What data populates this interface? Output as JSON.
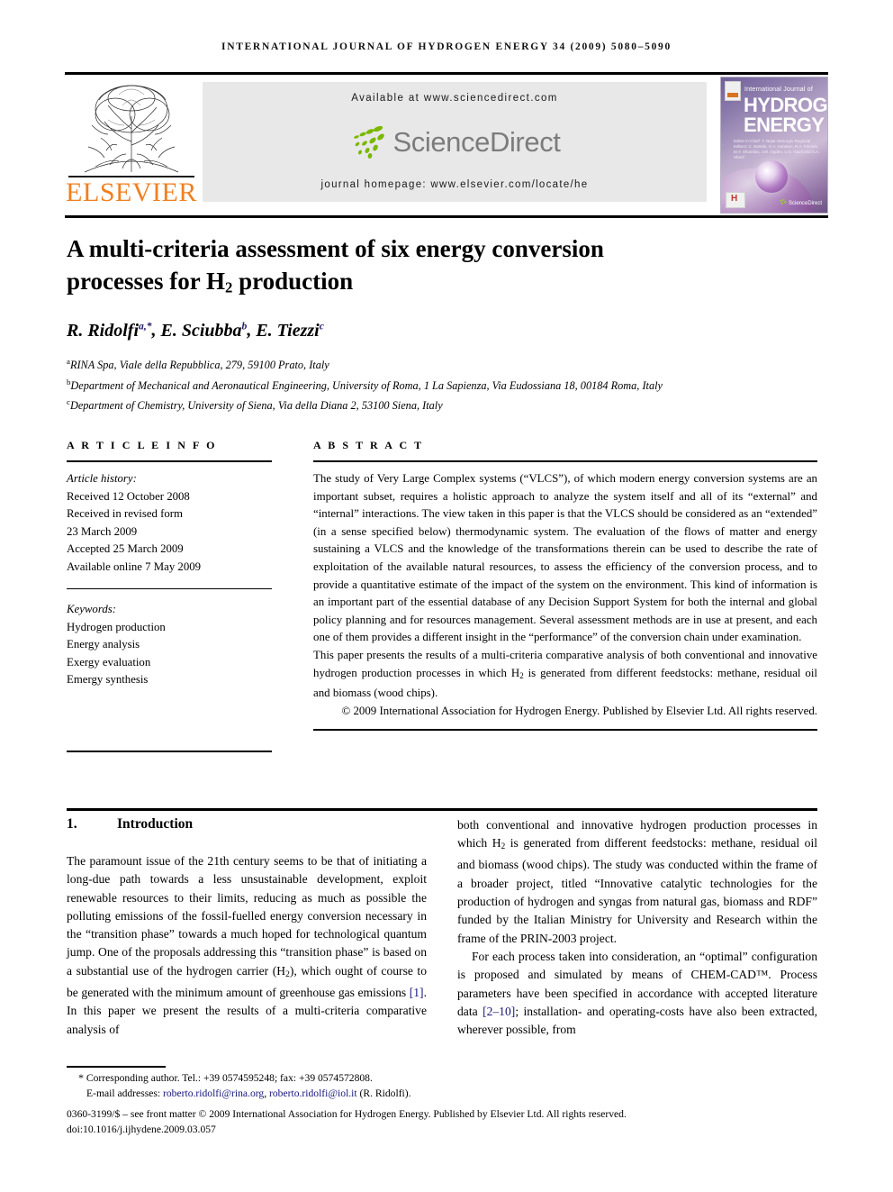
{
  "running_head": "International Journal of Hydrogen Energy 34 (2009) 5080–5090",
  "masthead": {
    "publisher_name": "ELSEVIER",
    "available_at": "Available at www.sciencedirect.com",
    "sciencedirect_wordmark": "ScienceDirect",
    "journal_homepage": "journal homepage: www.elsevier.com/locate/he",
    "cover": {
      "line1": "International Journal of",
      "line2": "HYDROGEN",
      "line3": "ENERGY",
      "editors": "Editor-in-Chief:  T. Nejat Veziroglu    Regional Editors:  C. Bartels, G.A. Karakoc, R.A. Ferrara, M.Y. Shumilov, J.M. Ogden, U.S. Gavit and S.A. Sherif",
      "sciencedirect_badge": "ScienceDirect"
    }
  },
  "article": {
    "title_line1": "A multi-criteria assessment of six energy conversion",
    "title_line2_pre": "processes for H",
    "title_sub": "2",
    "title_line2_post": " production",
    "authors": [
      {
        "name": "R. Ridolfi",
        "sup": "a,*"
      },
      {
        "name": "E. Sciubba",
        "sup": "b"
      },
      {
        "name": "E. Tiezzi",
        "sup": "c"
      }
    ],
    "affiliations": [
      {
        "mark": "a",
        "text": "RINA Spa, Viale della Repubblica, 279, 59100 Prato, Italy"
      },
      {
        "mark": "b",
        "text": "Department of Mechanical and Aeronautical Engineering, University of Roma, 1 La Sapienza, Via Eudossiana 18, 00184 Roma, Italy"
      },
      {
        "mark": "c",
        "text": "Department of Chemistry, University of Siena, Via della Diana 2, 53100 Siena, Italy"
      }
    ]
  },
  "article_info": {
    "heading": "A R T I C L E   I N F O",
    "history_label": "Article history:",
    "history": [
      "Received 12 October 2008",
      "Received in revised form",
      "23 March 2009",
      "Accepted 25 March 2009",
      "Available online 7 May 2009"
    ],
    "keywords_label": "Keywords:",
    "keywords": [
      "Hydrogen production",
      "Energy analysis",
      "Exergy evaluation",
      "Emergy synthesis"
    ]
  },
  "abstract": {
    "heading": "A B S T R A C T",
    "paragraph1": "The study of Very Large Complex systems (“VLCS”), of which modern energy conversion systems are an important subset, requires a holistic approach to analyze the system itself and all of its “external” and “internal” interactions. The view taken in this paper is that the VLCS should be considered as an “extended” (in a sense specified below) thermodynamic system. The evaluation of the flows of matter and energy sustaining a VLCS and the knowledge of the transformations therein can be used to describe the rate of exploitation of the available natural resources, to assess the efficiency of the conversion process, and to provide a quantitative estimate of the impact of the system on the environment. This kind of information is an important part of the essential database of any Decision Support System for both the internal and global policy planning and for resources management. Several assessment methods are in use at present, and each one of them provides a different insight in the “performance” of the conversion chain under examination.",
    "paragraph2_pre": "This paper presents the results of a multi-criteria comparative analysis of both conventional and innovative hydrogen production processes in which H",
    "paragraph2_sub": "2",
    "paragraph2_post": " is generated from different feedstocks: methane, residual oil and biomass (wood chips).",
    "copyright": "© 2009 International Association for Hydrogen Energy. Published by Elsevier Ltd. All rights reserved."
  },
  "body": {
    "section_number": "1.",
    "section_title": "Introduction",
    "left_p1_a": "The paramount issue of the 21th century seems to be that of initiating a long-due path towards a less unsustainable development, exploit renewable resources to their limits, reducing as much as possible the polluting emissions of the fossil-fuelled energy conversion necessary in the “transition phase” towards a much hoped for technological quantum jump. One of the proposals addressing this “transition phase” is based on a substantial use of the hydrogen carrier (H",
    "left_p1_sub": "2",
    "left_p1_b": "), which ought of course to be generated with the minimum amount of greenhouse gas emissions ",
    "left_p1_ref": "[1]",
    "left_p1_c": ". In this paper we present the results of a multi-criteria comparative analysis of",
    "right_p1_a": "both conventional and innovative hydrogen production processes in which H",
    "right_p1_sub": "2",
    "right_p1_b": " is generated from different feedstocks: methane, residual oil and biomass (wood chips). The study was conducted within the frame of a broader project, titled “Innovative catalytic technologies for the production of hydrogen and syngas from natural gas, biomass and RDF” funded by the Italian Ministry for University and Research within the frame of the PRIN-2003 project.",
    "right_p2_a": "For each process taken into consideration, an “optimal” configuration is proposed and simulated by means of CHEM-CAD™. Process parameters have been specified in accordance with accepted literature data ",
    "right_p2_ref": "[2–10]",
    "right_p2_b": "; installation- and operating-costs have also been extracted, wherever possible, from"
  },
  "footer": {
    "corresponding": "Corresponding author. Tel.: +39 0574595248; fax: +39 0574572808.",
    "email_label": "E-mail addresses:",
    "email1": "roberto.ridolfi@rina.org",
    "email_sep": ", ",
    "email2": "roberto.ridolfi@iol.it",
    "email_suffix": " (R. Ridolfi).",
    "issn_line": "0360-3199/$ – see front matter © 2009 International Association for Hydrogen Energy. Published by Elsevier Ltd. All rights reserved.",
    "doi_line": "doi:10.1016/j.ijhydene.2009.03.057"
  },
  "colors": {
    "elsevier_orange": "#F08020",
    "sciencedirect_green": "#7AB800",
    "sciencedirect_gray": "#7c7c7c",
    "link_blue": "#15157a",
    "panel_gray": "#e8e8e8"
  }
}
